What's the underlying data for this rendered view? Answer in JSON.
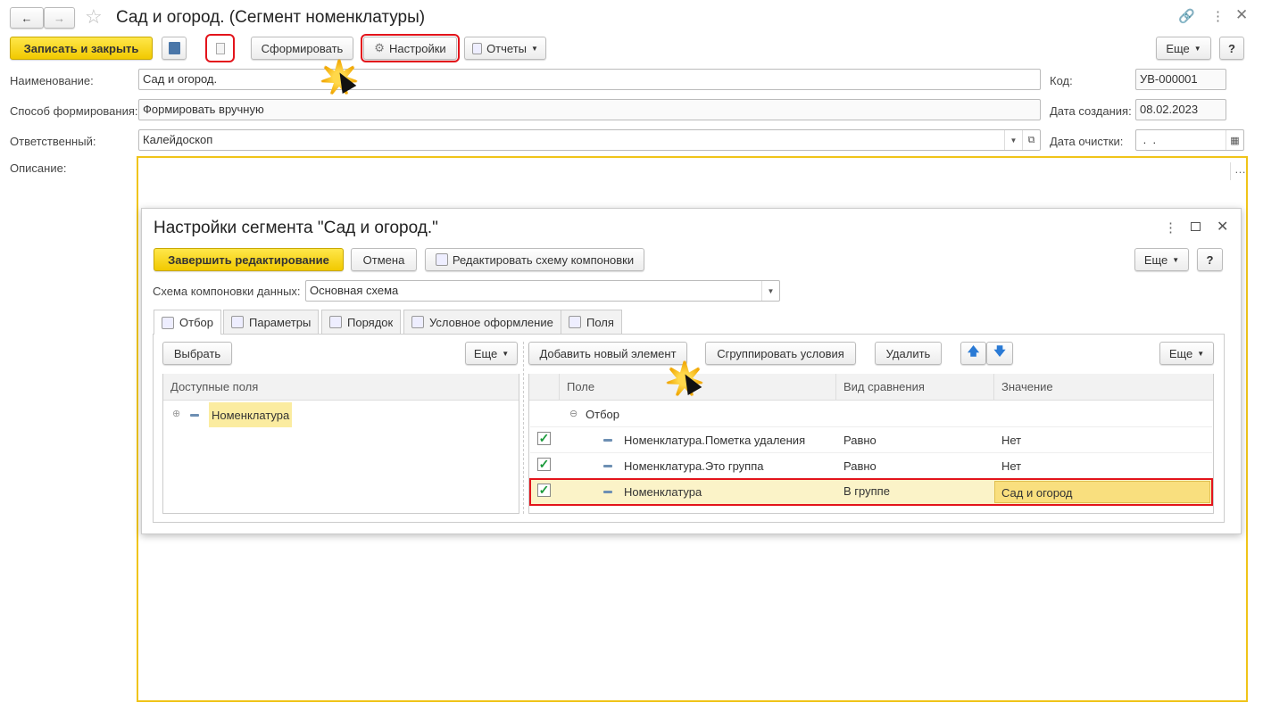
{
  "window": {
    "title": "Сад и огород. (Сегмент номенклатуры)"
  },
  "toolbar": {
    "save_close": "Записать и закрыть",
    "generate": "Сформировать",
    "settings": "Настройки",
    "reports": "Отчеты",
    "more": "Еще",
    "help": "?"
  },
  "fields": {
    "name_label": "Наименование:",
    "name_value": "Сад и огород.",
    "method_label": "Способ формирования:",
    "method_value": "Формировать вручную",
    "responsible_label": "Ответственный:",
    "responsible_value": "Калейдоскоп",
    "description_label": "Описание:",
    "code_label": "Код:",
    "code_value": "УВ-000001",
    "created_label": "Дата создания:",
    "created_value": "08.02.2023",
    "clear_label": "Дата очистки:",
    "clear_value": " .  ."
  },
  "dialog": {
    "title": "Настройки сегмента \"Сад и огород.\"",
    "finish": "Завершить редактирование",
    "cancel": "Отмена",
    "edit_schema": "Редактировать схему компоновки",
    "more": "Еще",
    "help": "?",
    "schema_label": "Схема компоновки данных:",
    "schema_value": "Основная схема",
    "tabs": [
      "Отбор",
      "Параметры",
      "Порядок",
      "Условное оформление",
      "Поля"
    ],
    "left": {
      "select": "Выбрать",
      "more": "Еще",
      "header": "Доступные поля",
      "item": "Номенклатура"
    },
    "right": {
      "add": "Добавить новый элемент",
      "group": "Сгруппировать условия",
      "delete": "Удалить",
      "more": "Еще",
      "columns": [
        "Поле",
        "Вид сравнения",
        "Значение"
      ],
      "group_row": "Отбор",
      "rows": [
        {
          "field": "Номенклатура.Пометка удаления",
          "cmp": "Равно",
          "value": "Нет"
        },
        {
          "field": "Номенклатура.Это группа",
          "cmp": "Равно",
          "value": "Нет"
        },
        {
          "field": "Номенклатура",
          "cmp": "В группе",
          "value": "Сад и огород"
        }
      ]
    }
  }
}
